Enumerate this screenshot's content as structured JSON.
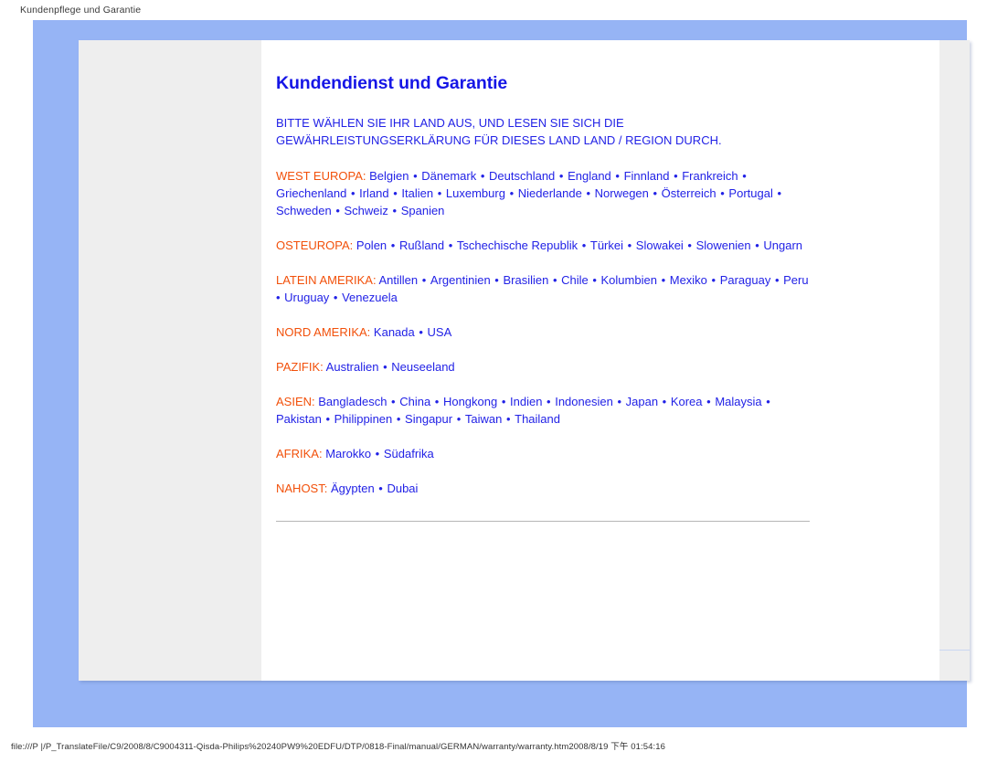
{
  "print_header": {
    "title": "Kundenpflege und Garantie"
  },
  "document": {
    "title": "Kundendienst und Garantie",
    "subtitle": "BITTE WÄHLEN SIE IHR LAND AUS, UND LESEN SIE SICH DIE GEWÄHRLEISTUNGSERKLÄRUNG FÜR DIESES LAND LAND / REGION DURCH.",
    "separator": "•",
    "regions": [
      {
        "label": "WEST EUROPA:",
        "countries": [
          "Belgien",
          "Dänemark",
          "Deutschland",
          "England",
          "Finnland",
          "Frankreich",
          "Griechenland",
          "Irland",
          "Italien",
          "Luxemburg",
          "Niederlande",
          "Norwegen",
          "Österreich",
          "Portugal",
          "Schweden",
          "Schweiz",
          "Spanien"
        ]
      },
      {
        "label": "OSTEUROPA:",
        "countries": [
          "Polen",
          "Rußland",
          "Tschechische Republik",
          "Türkei",
          "Slowakei",
          "Slowenien",
          "Ungarn"
        ]
      },
      {
        "label": "LATEIN AMERIKA:",
        "countries": [
          "Antillen",
          "Argentinien",
          "Brasilien",
          "Chile",
          "Kolumbien",
          "Mexiko",
          "Paraguay",
          "Peru",
          "Uruguay",
          "Venezuela"
        ]
      },
      {
        "label": "NORD AMERIKA:",
        "countries": [
          "Kanada",
          "USA"
        ]
      },
      {
        "label": "PAZIFIK:",
        "countries": [
          "Australien",
          "Neuseeland"
        ]
      },
      {
        "label": "ASIEN:",
        "countries": [
          "Bangladesch",
          "China",
          "Hongkong",
          "Indien",
          "Indonesien",
          "Japan",
          "Korea",
          "Malaysia",
          "Pakistan",
          "Philippinen",
          "Singapur",
          "Taiwan",
          "Thailand"
        ]
      },
      {
        "label": "AFRIKA:",
        "countries": [
          "Marokko",
          "Südafrika"
        ]
      },
      {
        "label": "NAHOST:",
        "countries": [
          "Ägypten",
          "Dubai"
        ]
      }
    ]
  },
  "print_footer": {
    "url": "file:///P |/P_TranslateFile/C9/2008/8/C9004311-Qisda-Philips%20240PW9%20EDFU/DTP/0818-Final/manual/GERMAN/warranty/warranty.htm2008/8/19 下午 01:54:16"
  },
  "colors": {
    "frame_blue": "#96b4f5",
    "heading_blue": "#1616e6",
    "link_blue": "#2222e6",
    "region_label_orange": "#f2500a",
    "sheet_grey": "#eeeeee",
    "rule_grey": "#b5b5b5"
  }
}
